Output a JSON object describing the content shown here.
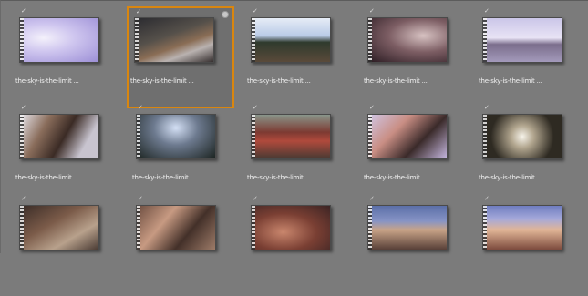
{
  "browser": {
    "clips": [
      {
        "label": "the-sky-is-the-limit ...",
        "selected": false,
        "thumb_class": "t1"
      },
      {
        "label": "the-sky-is-the-limit ...",
        "selected": true,
        "thumb_class": "t2"
      },
      {
        "label": "the-sky-is-the-limit ...",
        "selected": false,
        "thumb_class": "t3"
      },
      {
        "label": "the-sky-is-the-limit ...",
        "selected": false,
        "thumb_class": "t4"
      },
      {
        "label": "the-sky-is-the-limit ...",
        "selected": false,
        "thumb_class": "t5"
      },
      {
        "label": "the-sky-is-the-limit ...",
        "selected": false,
        "thumb_class": "t6"
      },
      {
        "label": "the-sky-is-the-limit ...",
        "selected": false,
        "thumb_class": "t7"
      },
      {
        "label": "the-sky-is-the-limit ...",
        "selected": false,
        "thumb_class": "t8"
      },
      {
        "label": "the-sky-is-the-limit ...",
        "selected": false,
        "thumb_class": "t9"
      },
      {
        "label": "the-sky-is-the-limit ...",
        "selected": false,
        "thumb_class": "t10"
      },
      {
        "label": "",
        "selected": false,
        "thumb_class": "t11"
      },
      {
        "label": "",
        "selected": false,
        "thumb_class": "t12"
      },
      {
        "label": "",
        "selected": false,
        "thumb_class": "t13"
      },
      {
        "label": "",
        "selected": false,
        "thumb_class": "t14"
      },
      {
        "label": "",
        "selected": false,
        "thumb_class": "t15"
      }
    ],
    "check_glyph": "✓",
    "colors": {
      "background": "#7b7b7b",
      "selection_border": "#d9860f",
      "label_text": "#f2f2f2"
    },
    "icons": {
      "check": "checkmark-icon",
      "corner": "corner-badge-icon",
      "film": "filmstrip-icon"
    }
  }
}
